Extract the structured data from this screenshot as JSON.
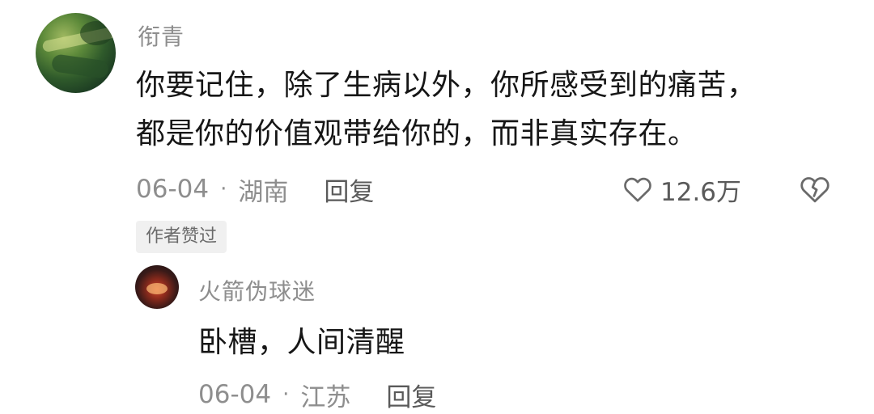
{
  "comment": {
    "username": "衔青",
    "text_line1": "你要记住，除了生病以外，你所感受到的痛苦，",
    "text_line2": "都是你的价值观带给你的，而非真实存在。",
    "date": "06-04",
    "separator": "·",
    "location": "湖南",
    "reply_label": "回复",
    "like_count": "12.6万",
    "author_liked_badge": "作者赞过",
    "icons": {
      "like": "heart-icon",
      "dislike": "broken-heart-icon"
    }
  },
  "reply": {
    "username": "火箭伪球迷",
    "text": "卧槽，人间清醒",
    "date": "06-04",
    "separator": "·",
    "location": "江苏",
    "reply_label": "回复"
  },
  "colors": {
    "text_primary": "#161616",
    "text_secondary": "#8e8e8e",
    "text_action": "#5a5a5a",
    "badge_bg": "#f0f0f0"
  }
}
